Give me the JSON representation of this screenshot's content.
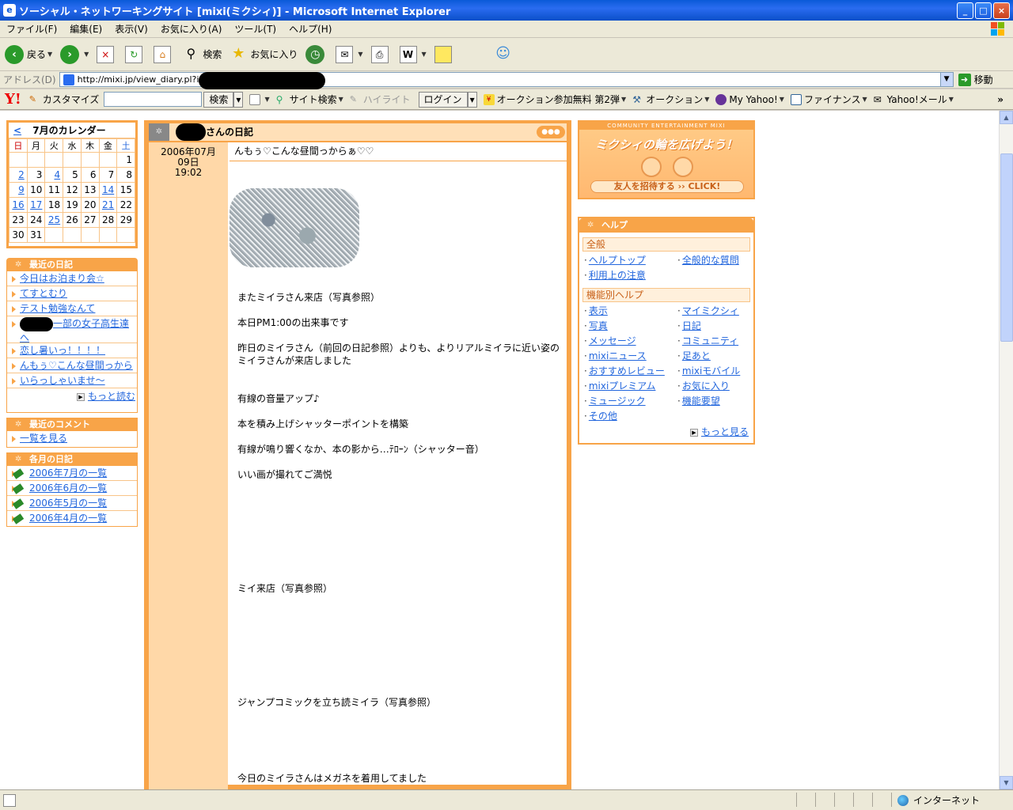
{
  "window": {
    "title": "ソーシャル・ネットワーキングサイト [mixi(ミクシィ)] - Microsoft Internet Explorer",
    "min": "_",
    "max": "□",
    "close": "×"
  },
  "menu": [
    "ファイル(F)",
    "編集(E)",
    "表示(V)",
    "お気に入り(A)",
    "ツール(T)",
    "ヘルプ(H)"
  ],
  "toolbar": {
    "back": "戻る",
    "search": "検索",
    "favorites": "お気に入り"
  },
  "address": {
    "label": "アドレス(D)",
    "url": "http://mixi.jp/view_diary.pl?id=",
    "go": "移動"
  },
  "yahoo_toolbar": {
    "logo": "Y!",
    "customize": "カスタマイズ",
    "search_btn": "検索",
    "site_search": "サイト検索",
    "highlight": "ハイライト",
    "login": "ログイン",
    "auction_promo": "オークション参加無料 第2弾",
    "auction": "オークション",
    "myyahoo": "My Yahoo!",
    "finance": "ファイナンス",
    "mail": "Yahoo!メール"
  },
  "calendar": {
    "prev": "<",
    "title": "7月のカレンダー",
    "headers": [
      "日",
      "月",
      "火",
      "水",
      "木",
      "金",
      "土"
    ],
    "weeks": [
      [
        "",
        "",
        "",
        "",
        "",
        "",
        "1"
      ],
      [
        "2",
        "3",
        "4",
        "5",
        "6",
        "7",
        "8"
      ],
      [
        "9",
        "10",
        "11",
        "12",
        "13",
        "14",
        "15"
      ],
      [
        "16",
        "17",
        "18",
        "19",
        "20",
        "21",
        "22"
      ],
      [
        "23",
        "24",
        "25",
        "26",
        "27",
        "28",
        "29"
      ],
      [
        "30",
        "31",
        "",
        "",
        "",
        "",
        ""
      ]
    ],
    "linked_days": [
      "2",
      "4",
      "9",
      "14",
      "16",
      "17",
      "21",
      "25"
    ]
  },
  "recent_diary": {
    "title": "最近の日記",
    "items": [
      "今日はお泊まり会☆",
      "てすとむり",
      "テスト勉強なんて",
      "一部の女子高生達へ",
      "恋し暑いっ！！！！",
      "んもぅ♡こんな昼間っから",
      "いらっしゃいませ〜"
    ],
    "more": "もっと読む"
  },
  "recent_comments": {
    "title": "最近のコメント",
    "items": [
      "一覧を見る"
    ]
  },
  "monthly_diary": {
    "title": "各月の日記",
    "items": [
      "2006年7月の一覧",
      "2006年6月の一覧",
      "2006年5月の一覧",
      "2006年4月の一覧"
    ]
  },
  "diary": {
    "header_suffix": "さんの日記",
    "date": "2006年07月09日",
    "time": "19:02",
    "title": "んもぅ♡こんな昼間っからぁ♡♡",
    "paragraphs": [
      "またミイラさん来店（写真参照）",
      "本日PM1:00の出来事です",
      "昨日のミイラさん（前回の日記参照）よりも、よりリアルミイラに近い姿のミイラさんが来店しました",
      "有線の音量アップ♪",
      "本を積み上げシャッターポイントを構築",
      "有線が鳴り響くなか、本の影から…ﾃﾛｰﾝ（シャッター音）",
      "いい画が撮れてご満悦",
      "ミイ来店（写真参照）",
      "ジャンプコミックを立ち読ミイラ（写真参照）",
      "今日のミイラさんはメガネを着用してました"
    ]
  },
  "invite": {
    "top": "COMMUNITY ENTERTAINMENT MIXI",
    "title": "ミクシィの輪を広げよう！",
    "button": "友人を招待する ›› CLICK!"
  },
  "help": {
    "title": "ヘルプ",
    "general_title": "全般",
    "general": [
      "ヘルプトップ",
      "全般的な質問",
      "利用上の注意"
    ],
    "feature_title": "機能別ヘルプ",
    "feature": [
      "表示",
      "マイミクシィ",
      "写真",
      "日記",
      "メッセージ",
      "コミュニティ",
      "mixiニュース",
      "足あと",
      "おすすめレビュー",
      "mixiモバイル",
      "mixiプレミアム",
      "お気に入り",
      "ミュージック",
      "機能要望",
      "その他"
    ],
    "more": "もっと見る"
  },
  "status": {
    "zone": "インターネット"
  }
}
